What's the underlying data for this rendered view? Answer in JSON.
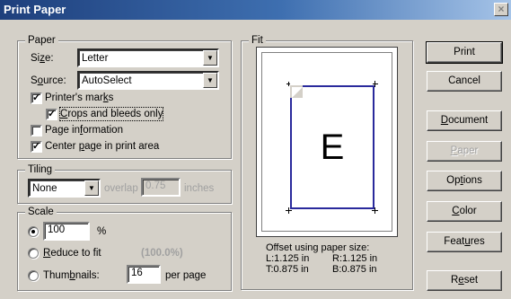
{
  "window": {
    "title": "Print Paper",
    "close_glyph": "×"
  },
  "paper": {
    "legend": "Paper",
    "size_label": "Size:",
    "size_value": "Letter",
    "source_label": "Source:",
    "source_value": "AutoSelect",
    "printers_marks": {
      "label": "Printer's marks",
      "checked": true
    },
    "crops_bleeds": {
      "label": "Crops and bleeds only",
      "checked": true
    },
    "page_info": {
      "label": "Page information",
      "checked": false
    },
    "center_page": {
      "label": "Center page in print area",
      "checked": true
    }
  },
  "tiling": {
    "legend": "Tiling",
    "value": "None",
    "overlap_label": "overlap",
    "overlap_value": "0.75",
    "overlap_unit": "inches"
  },
  "scale": {
    "legend": "Scale",
    "percent_value": "100",
    "percent_symbol": "%",
    "reduce_label": "Reduce to fit",
    "reduce_value": "(100.0%)",
    "thumbnails_label": "Thumbnails:",
    "thumbnails_value": "16",
    "thumbnails_unit": "per page",
    "selected": "percent"
  },
  "fit": {
    "legend": "Fit",
    "preview_letter": "E",
    "offset_title": "Offset using paper size:",
    "offset_left": "L:1.125 in",
    "offset_right": "R:1.125 in",
    "offset_top": "T:0.875 in",
    "offset_bottom": "B:0.875 in"
  },
  "buttons": {
    "print": "Print",
    "cancel": "Cancel",
    "document": "Document",
    "paper": "Paper",
    "options": "Options",
    "color": "Color",
    "features": "Features",
    "reset": "Reset"
  },
  "colors": {
    "title_gradient_start": "#1e3f7c",
    "title_gradient_end": "#a6c4e8",
    "preview_border": "#2a2a9c"
  }
}
